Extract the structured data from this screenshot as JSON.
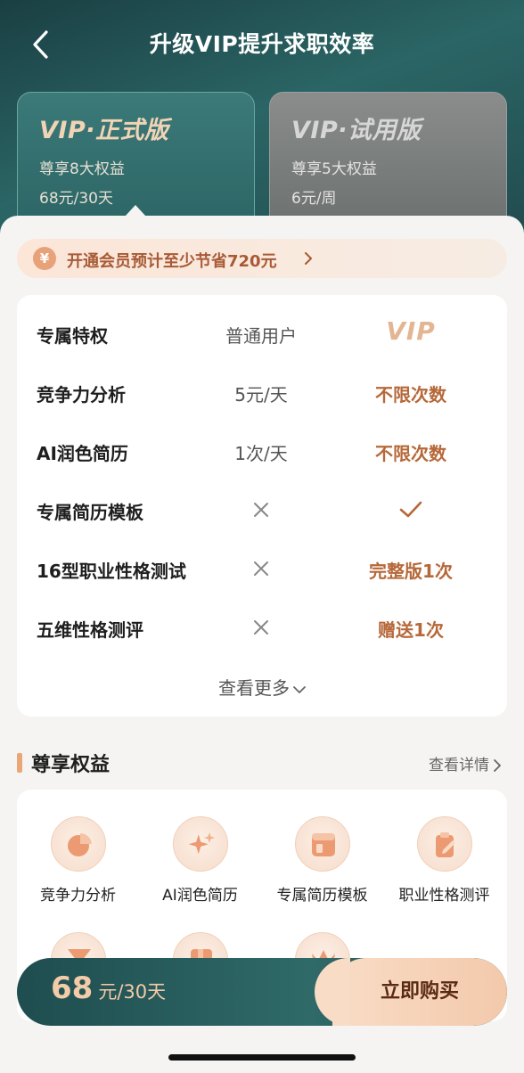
{
  "header": {
    "title": "升级VIP提升求职效率"
  },
  "plans": [
    {
      "name": "VIP·正式版",
      "benefit": "尊享8大权益",
      "price": "68元/30天"
    },
    {
      "name": "VIP·试用版",
      "benefit": "尊享5大权益",
      "price": "6元/周"
    }
  ],
  "promo": {
    "icon_text": "¥",
    "text": "开通会员预计至少节省720元"
  },
  "compare": {
    "header": {
      "feature": "专属特权",
      "normal": "普通用户",
      "vip": "VIP"
    },
    "rows": [
      {
        "feature": "竞争力分析",
        "normal": "5元/天",
        "vip": "不限次数"
      },
      {
        "feature": "AI润色简历",
        "normal": "1次/天",
        "vip": "不限次数"
      },
      {
        "feature": "专属简历模板",
        "normal": "",
        "vip": ""
      },
      {
        "feature": "16型职业性格测试",
        "normal": "",
        "vip": "完整版1次"
      },
      {
        "feature": "五维性格测评",
        "normal": "",
        "vip": "赠送1次"
      }
    ],
    "see_more": "查看更多"
  },
  "benefits_section": {
    "title": "尊享权益",
    "link": "查看详情",
    "items": [
      {
        "label": "竞争力分析",
        "icon": "pie-chart-icon"
      },
      {
        "label": "AI润色简历",
        "icon": "sparkle-icon"
      },
      {
        "label": "专属简历模板",
        "icon": "template-icon"
      },
      {
        "label": "职业性格测评",
        "icon": "clipboard-icon"
      },
      {
        "label": "",
        "icon": "funnel-icon"
      },
      {
        "label": "",
        "icon": "book-icon"
      },
      {
        "label": "",
        "icon": "crown-icon"
      }
    ]
  },
  "buy": {
    "price_num": "68",
    "price_unit": "元/30天",
    "button": "立即购买"
  },
  "colors": {
    "accent": "#b66839",
    "teal": "#2b6565",
    "gold": "#f3cba8"
  }
}
